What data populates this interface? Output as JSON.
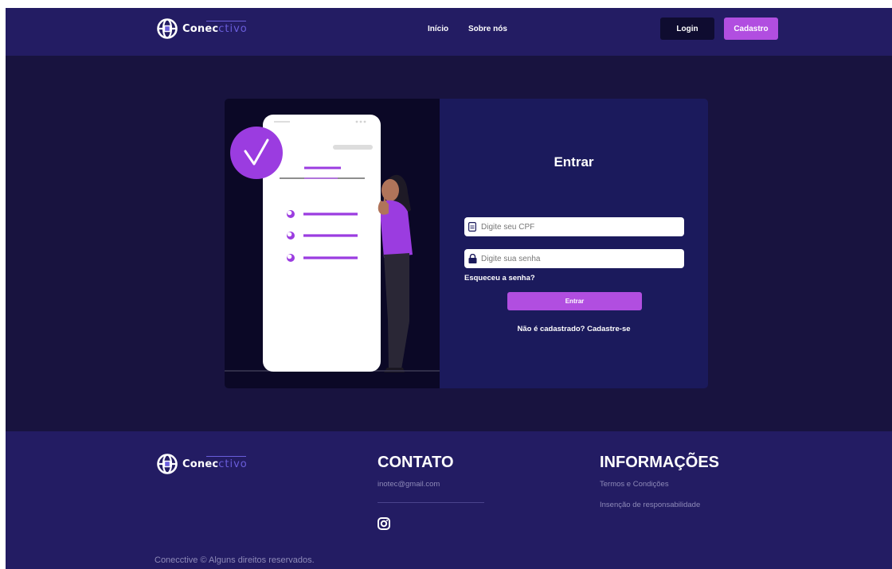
{
  "header": {
    "logo": {
      "text_a": "Conec",
      "text_b": "ctivo"
    },
    "nav": [
      {
        "label": "Início"
      },
      {
        "label": "Sobre nós"
      }
    ],
    "login_label": "Login",
    "signup_label": "Cadastro"
  },
  "login": {
    "title": "Entrar",
    "cpf_placeholder": "Digite seu CPF",
    "password_placeholder": "Digite sua senha",
    "forgot_label": "Esqueceu a senha?",
    "submit_label": "Entrar",
    "signup_prompt": "Não é cadastrado? Cadastre-se"
  },
  "footer": {
    "logo": {
      "text_a": "Conec",
      "text_b": "ctivo"
    },
    "contact_title": "CONTATO",
    "contact_email": "inotec@gmail.com",
    "social_icon": "instagram-icon",
    "info_title": "INFORMAÇÕES",
    "info_links": [
      {
        "label": "Termos e Condições"
      },
      {
        "label": "Insenção de responsabilidade"
      }
    ],
    "copyright": "Conecctive © Alguns direitos reservados."
  },
  "colors": {
    "page_bg": "#18133f",
    "header_bg": "#231c63",
    "accent": "#b14ee0",
    "login_btn": "#0f0c30",
    "form_panel": "#1b1a5c"
  }
}
